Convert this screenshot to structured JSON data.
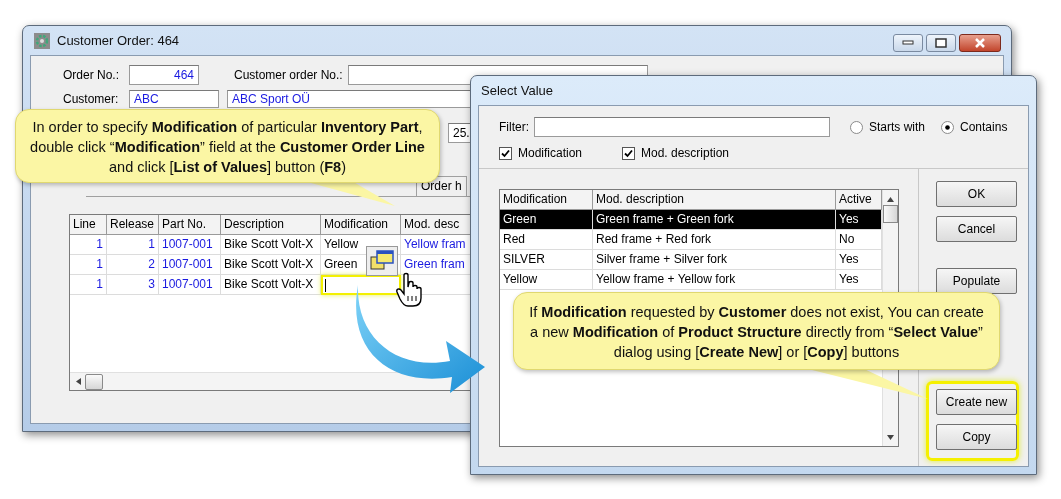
{
  "main_window": {
    "title": "Customer Order: 464",
    "order_no": {
      "label": "Order No.:",
      "value": "464"
    },
    "customer_order_no": {
      "label": "Customer order No.:"
    },
    "customer": {
      "label": "Customer:",
      "code": "ABC",
      "name": "ABC Sport OÜ"
    },
    "date_field": {
      "value": "25."
    },
    "tabs": [
      "Order h"
    ],
    "table": {
      "columns": [
        "Line",
        "Release",
        "Part No.",
        "Description",
        "Modification",
        "Mod. desc"
      ],
      "rows": [
        {
          "line": "1",
          "release": "1",
          "part_no": "1007-001",
          "description": "Bike Scott Volt-X",
          "modification": "Yellow",
          "mod_desc": "Yellow fram",
          "editing": false
        },
        {
          "line": "1",
          "release": "2",
          "part_no": "1007-001",
          "description": "Bike Scott Volt-X",
          "modification": "Green",
          "mod_desc": "Green fram",
          "editing": false
        },
        {
          "line": "1",
          "release": "3",
          "part_no": "1007-001",
          "description": "Bike Scott Volt-X",
          "editing": true
        }
      ]
    }
  },
  "select_value_dialog": {
    "title": "Select Value",
    "filter": {
      "label": "Filter:"
    },
    "match": [
      {
        "label": "Starts with",
        "selected": false
      },
      {
        "label": "Contains",
        "selected": true
      }
    ],
    "search_in": [
      {
        "label": "Modification",
        "checked": true
      },
      {
        "label": "Mod. description",
        "checked": true
      }
    ],
    "grid": {
      "columns": [
        "Modification",
        "Mod. description",
        "Active"
      ],
      "rows": [
        {
          "cells": [
            "Green",
            "Green frame + Green fork",
            "Yes"
          ],
          "selected": true
        },
        {
          "cells": [
            "Red",
            "Red frame + Red fork",
            "No"
          ],
          "selected": false
        },
        {
          "cells": [
            "SILVER",
            "Silver frame + Silver fork",
            "Yes"
          ],
          "selected": false
        },
        {
          "cells": [
            "Yellow",
            "Yellow frame + Yellow fork",
            "Yes"
          ],
          "selected": false
        }
      ]
    },
    "buttons": [
      "OK",
      "Cancel",
      "Populate"
    ],
    "edit_buttons": {
      "highlighted": true,
      "items": [
        "Create new",
        "Copy"
      ]
    }
  },
  "callouts": [
    {
      "text": "In order to specify **Modification** of particular **Inventory Part**, double click “**Modification**” field at the **Customer Order Line** and click [**List of Values**] button (**F8**)"
    },
    {
      "text": "If **Modification** requested by **Customer** does not exist, You can create a new **Modification** of **Product Structure** directly from “**Select Value**” dialog using [**Create New**] or [**Copy**] buttons"
    }
  ]
}
